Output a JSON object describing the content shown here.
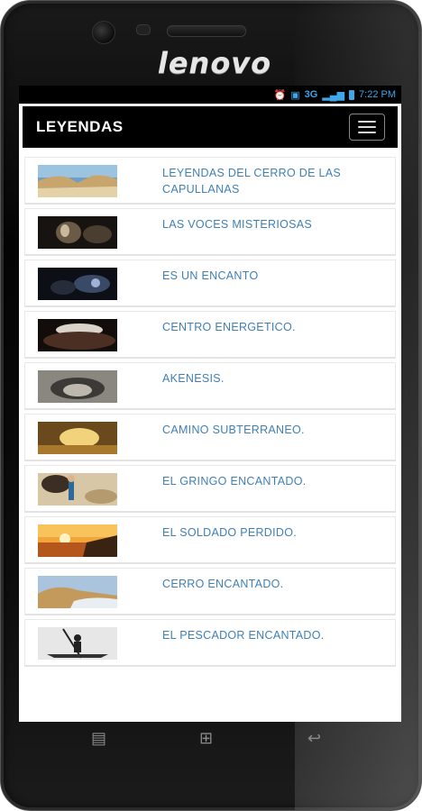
{
  "device": {
    "brand": "lenovo"
  },
  "status_bar": {
    "network": "3G",
    "time": "7:22 PM",
    "icons": [
      "alarm-icon",
      "sim-icon",
      "signal-icon",
      "battery-icon"
    ]
  },
  "app_bar": {
    "title": "LEYENDAS",
    "menu_icon": "hamburger-menu-icon"
  },
  "legends": [
    {
      "label": "LEYENDAS DEL CERRO DE LAS CAPULLANAS",
      "thumb": "coastal-cliff"
    },
    {
      "label": "LAS VOCES MISTERIOSAS",
      "thumb": "dark-cave"
    },
    {
      "label": "ES UN ENCANTO",
      "thumb": "cave-blue"
    },
    {
      "label": "CENTRO ENERGETICO.",
      "thumb": "cave-opening"
    },
    {
      "label": "AKENESIS.",
      "thumb": "rock-tunnel"
    },
    {
      "label": "CAMINO SUBTERRANEO.",
      "thumb": "sunlit-tunnel"
    },
    {
      "label": "EL GRINGO ENCANTADO.",
      "thumb": "person-cave"
    },
    {
      "label": "EL SOLDADO PERDIDO.",
      "thumb": "sunset-sea"
    },
    {
      "label": "CERRO ENCANTADO.",
      "thumb": "hill-beach"
    },
    {
      "label": "EL PESCADOR ENCANTADO.",
      "thumb": "fisherman"
    }
  ],
  "soft_keys": [
    "menu-key-icon",
    "home-key-icon",
    "back-key-icon"
  ],
  "colors": {
    "link_text": "#3f7fb5",
    "status_accent": "#3fa6e8",
    "app_bar_bg": "#000000"
  }
}
